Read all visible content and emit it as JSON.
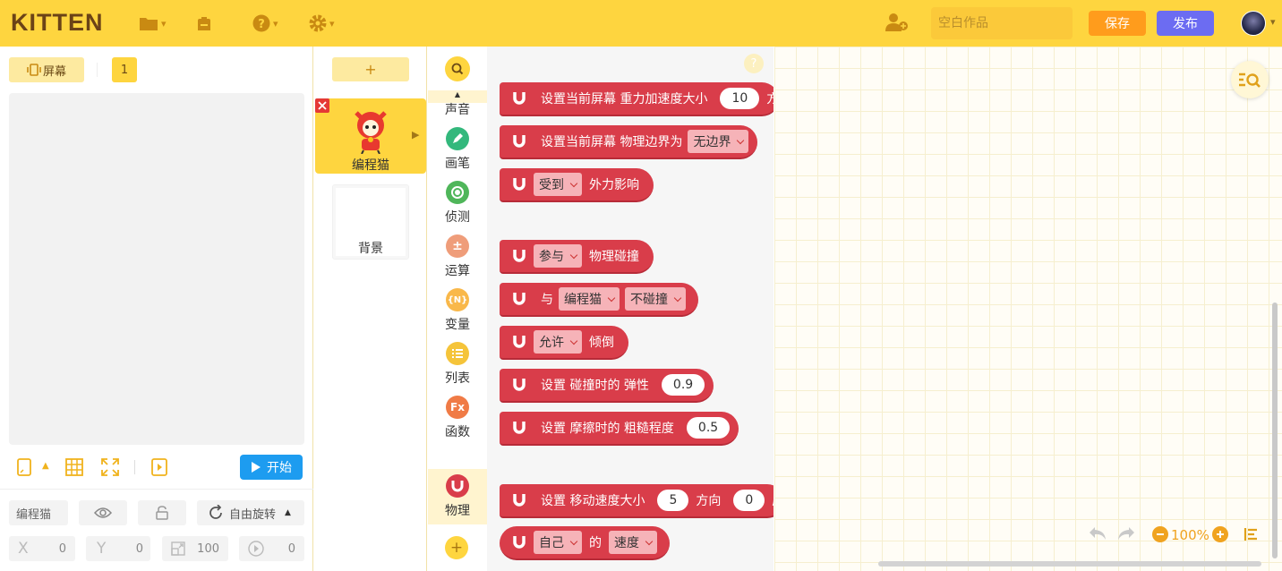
{
  "app": {
    "logo": "KITTEN"
  },
  "topbar": {
    "work_placeholder": "空白作品",
    "save_label": "保存",
    "publish_label": "发布"
  },
  "stage": {
    "screen_label": "屏幕",
    "screen_number": "1",
    "start_label": "开始"
  },
  "sprite_props": {
    "name": "编程猫",
    "rotation_mode": "自由旋转",
    "x_label": "X",
    "x_value": "0",
    "y_label": "Y",
    "y_value": "0",
    "size_value": "100",
    "angle_value": "0"
  },
  "sprites": {
    "add_label": "+",
    "items": [
      {
        "name": "编程猫",
        "selected": true
      },
      {
        "name": "背景",
        "selected": false
      }
    ]
  },
  "categories": {
    "items": [
      {
        "label": "声音",
        "icon": "sound-icon",
        "color": "#9b6bd8"
      },
      {
        "label": "画笔",
        "icon": "pen-icon",
        "color": "#33b87c"
      },
      {
        "label": "侦测",
        "icon": "detect-icon",
        "color": "#4fb65a"
      },
      {
        "label": "运算",
        "icon": "math-icon",
        "color": "#ef9d7a",
        "glyph": "±"
      },
      {
        "label": "变量",
        "icon": "variable-icon",
        "color": "#f9b84a",
        "glyph": "{N}"
      },
      {
        "label": "列表",
        "icon": "list-icon",
        "color": "#f5c43a"
      },
      {
        "label": "函数",
        "icon": "function-icon",
        "color": "#f07b46",
        "glyph": "Fx"
      },
      {
        "label": "物理",
        "icon": "physics-icon",
        "color": "#d93d4a"
      }
    ]
  },
  "blocks": {
    "b1": {
      "t1": "设置当前屏幕 重力加速度大小",
      "v1": "10",
      "t2": "方"
    },
    "b2": {
      "t1": "设置当前屏幕 物理边界为",
      "d1": "无边界"
    },
    "b3": {
      "d1": "受到",
      "t1": "外力影响"
    },
    "b4": {
      "d1": "参与",
      "t1": "物理碰撞"
    },
    "b5": {
      "t1": "与",
      "d1": "编程猫",
      "d2": "不碰撞"
    },
    "b6": {
      "d1": "允许",
      "t1": "倾倒"
    },
    "b7": {
      "t1": "设置 碰撞时的 弹性",
      "v1": "0.9"
    },
    "b8": {
      "t1": "设置 摩擦时的 粗糙程度",
      "v1": "0.5"
    },
    "b9": {
      "t1": "设置 移动速度大小",
      "v1": "5",
      "t2": "方向",
      "v2": "0",
      "t3": "度"
    },
    "b10": {
      "d1": "自己",
      "t1": "的",
      "d2": "速度"
    }
  },
  "workspace": {
    "zoom": "100%"
  },
  "colors": {
    "accent": "#fed53f",
    "save": "#ff9c1c",
    "publish": "#6c6cf2",
    "start": "#1d9cf0",
    "physics": "#d93d4a"
  }
}
